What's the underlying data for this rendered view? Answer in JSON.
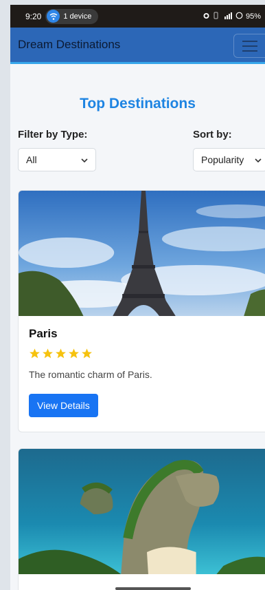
{
  "status": {
    "time": "9:20",
    "device_label": "1 device",
    "battery": "95%",
    "signal_text": "⁴ᴳ"
  },
  "navbar": {
    "brand": "Dream Destinations"
  },
  "page": {
    "heading": "Top Destinations"
  },
  "filters": {
    "type_label": "Filter by Type:",
    "type_value": "All",
    "sort_label": "Sort by:",
    "sort_value": "Popularity"
  },
  "cards": [
    {
      "title": "Paris",
      "rating": 5,
      "description": "The romantic charm of Paris.",
      "button": "View Details",
      "image_icon": "eiffel-tower-photo"
    },
    {
      "title": "",
      "image_icon": "tropical-cliff-photo"
    }
  ],
  "colors": {
    "navbar": "#2c67b7",
    "heading": "#1e84e2",
    "button": "#1874f3",
    "star": "#f6c20e"
  }
}
